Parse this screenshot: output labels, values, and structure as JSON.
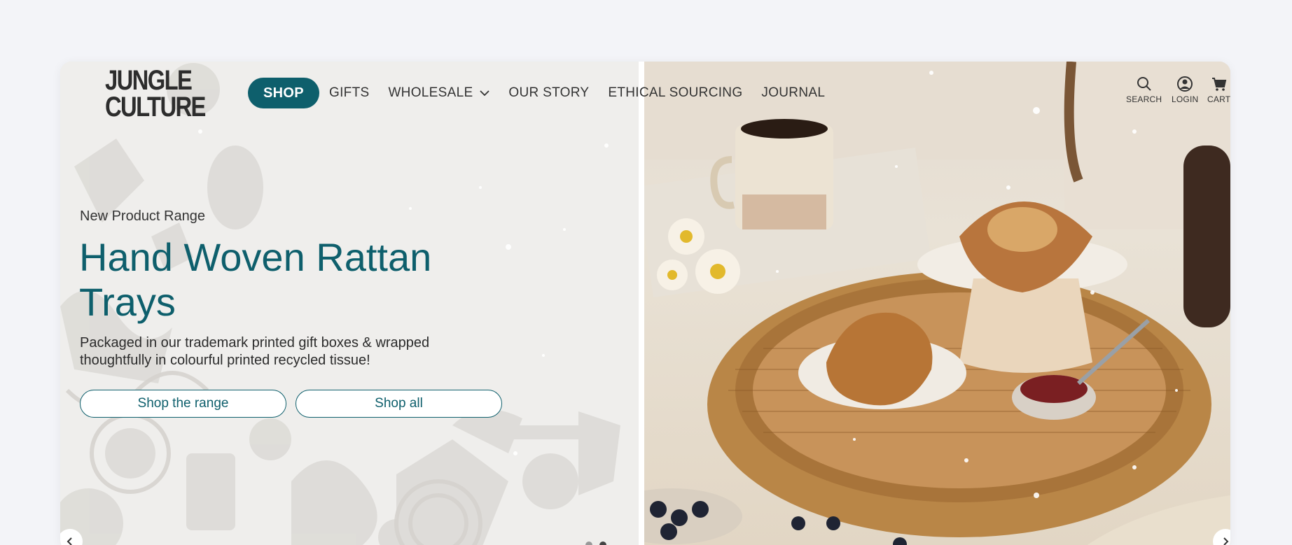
{
  "brand": {
    "logo_line1": "JUNGLE",
    "logo_line2": "CULTURE"
  },
  "nav": {
    "items": [
      {
        "label": "SHOP"
      },
      {
        "label": "GIFTS"
      },
      {
        "label": "WHOLESALE"
      },
      {
        "label": "OUR STORY"
      },
      {
        "label": "ETHICAL SOURCING"
      },
      {
        "label": "JOURNAL"
      }
    ]
  },
  "utility": {
    "search_label": "SEARCH",
    "login_label": "LOGIN",
    "cart_label": "CART"
  },
  "hero": {
    "eyebrow": "New Product Range",
    "headline_line1": "Hand Woven Rattan",
    "headline_line2": "Trays",
    "description_line1": "Packaged in our trademark printed gift boxes & wrapped",
    "description_line2": "thoughtfully in colourful printed recycled tissue!",
    "button_range": "Shop the range",
    "button_all": "Shop all"
  },
  "colors": {
    "brand_teal": "#0e5f6c",
    "background": "#f3f4f8",
    "panel": "#efeeec"
  },
  "icons": [
    "search-icon",
    "user-icon",
    "cart-icon",
    "chevron-down-icon",
    "chevron-left-icon",
    "chevron-right-icon"
  ]
}
